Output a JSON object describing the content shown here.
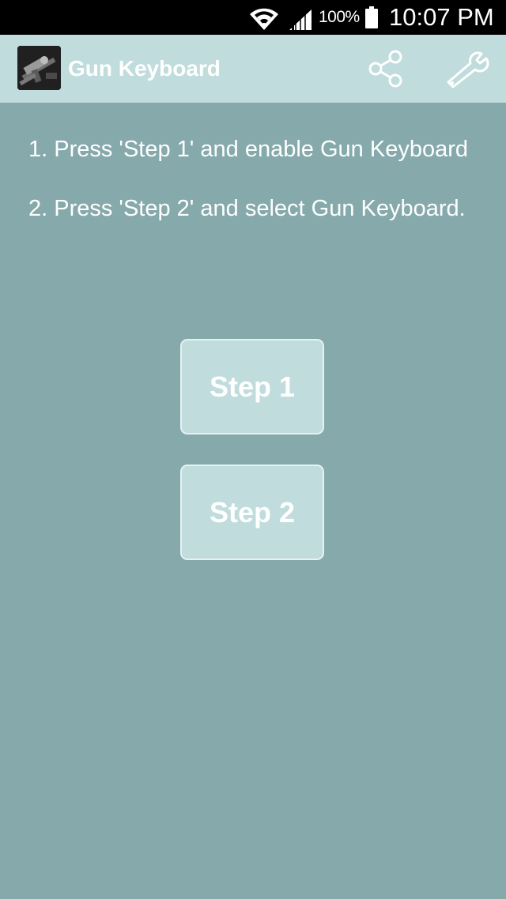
{
  "status_bar": {
    "battery_percent": "100%",
    "time": "10:07 PM",
    "icons": [
      "wifi-icon",
      "signal-icon",
      "battery-icon"
    ]
  },
  "app_bar": {
    "title": "Gun Keyboard",
    "icons": [
      "app-logo-icon",
      "share-icon",
      "wrench-icon"
    ]
  },
  "instructions": {
    "line1": "1. Press 'Step 1' and enable Gun Keyboard",
    "line2": "2. Press 'Step 2' and select Gun Keyboard."
  },
  "buttons": {
    "step1": "Step 1",
    "step2": "Step 2"
  },
  "colors": {
    "background": "#86a9ac",
    "app_bar": "#c0dcdc",
    "button": "#c0dcdc",
    "text": "#ffffff"
  }
}
